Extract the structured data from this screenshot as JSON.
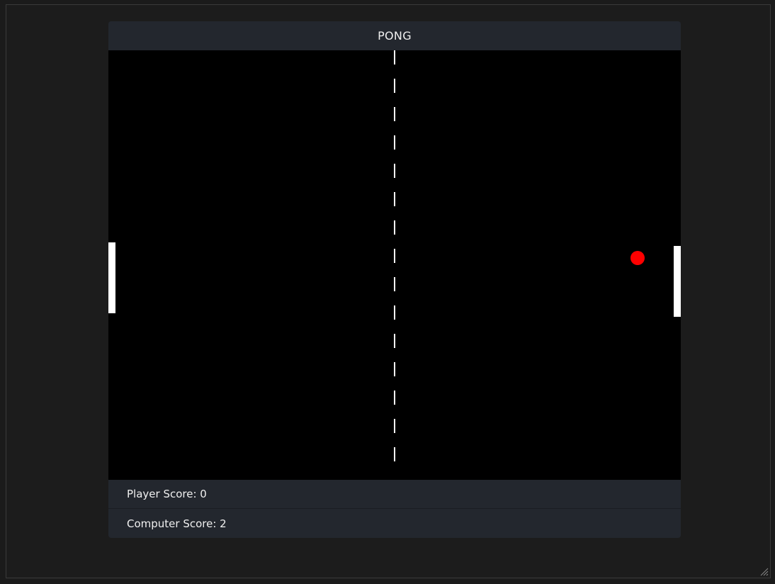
{
  "game": {
    "title": "PONG"
  },
  "scoreboard": {
    "player_label": "Player Score: 0",
    "computer_label": "Computer Score: 2",
    "player_score": 0,
    "computer_score": 2
  },
  "colors": {
    "court": "#000000",
    "paddle": "#ffffff",
    "ball": "#ff0000",
    "net": "#ffffff",
    "panel": "#23272e",
    "page_background": "#1b1b1b"
  },
  "icons": {
    "resize_grip": "resize-grip-icon"
  }
}
